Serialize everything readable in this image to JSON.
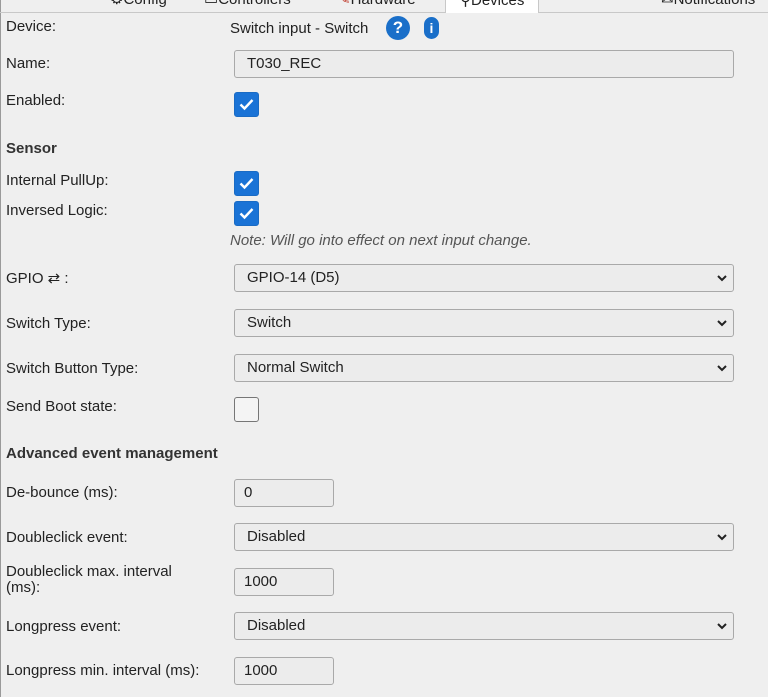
{
  "tabs": [
    {
      "label": "Config",
      "icon": "gear-icon"
    },
    {
      "label": "Controllers",
      "icon": "comment-icon"
    },
    {
      "label": "Hardware",
      "icon": "wrench-icon"
    },
    {
      "label": "Devices",
      "icon": "search-icon",
      "active": true
    },
    {
      "label": "Notifications",
      "icon": "envelope-icon"
    }
  ],
  "device": {
    "label": "Device:",
    "value": "Switch input - Switch"
  },
  "name": {
    "label": "Name:",
    "value": "T030_REC"
  },
  "enabled": {
    "label": "Enabled:",
    "checked": true
  },
  "sensor": {
    "heading": "Sensor",
    "pullup": {
      "label": "Internal PullUp:",
      "checked": true
    },
    "inversed": {
      "label": "Inversed Logic:",
      "checked": true
    },
    "note": "Note: Will go into effect on next input change.",
    "gpio": {
      "label": "GPIO ⇄ :",
      "value": "GPIO-14 (D5)"
    },
    "switch_type": {
      "label": "Switch Type:",
      "value": "Switch"
    },
    "switch_button_type": {
      "label": "Switch Button Type:",
      "value": "Normal Switch"
    },
    "send_boot": {
      "label": "Send Boot state:",
      "checked": false
    }
  },
  "advanced": {
    "heading": "Advanced event management",
    "debounce": {
      "label": "De-bounce (ms):",
      "value": "0"
    },
    "doubleclick": {
      "label": "Doubleclick event:",
      "value": "Disabled"
    },
    "doubleclick_interval": {
      "label_line1": "Doubleclick max. interval",
      "label_line2": "(ms):",
      "value": "1000"
    },
    "longpress": {
      "label": "Longpress event:",
      "value": "Disabled"
    },
    "longpress_interval": {
      "label": "Longpress min. interval (ms):",
      "value": "1000"
    }
  },
  "colors": {
    "accent": "#1a73d6",
    "background": "#efefef"
  }
}
